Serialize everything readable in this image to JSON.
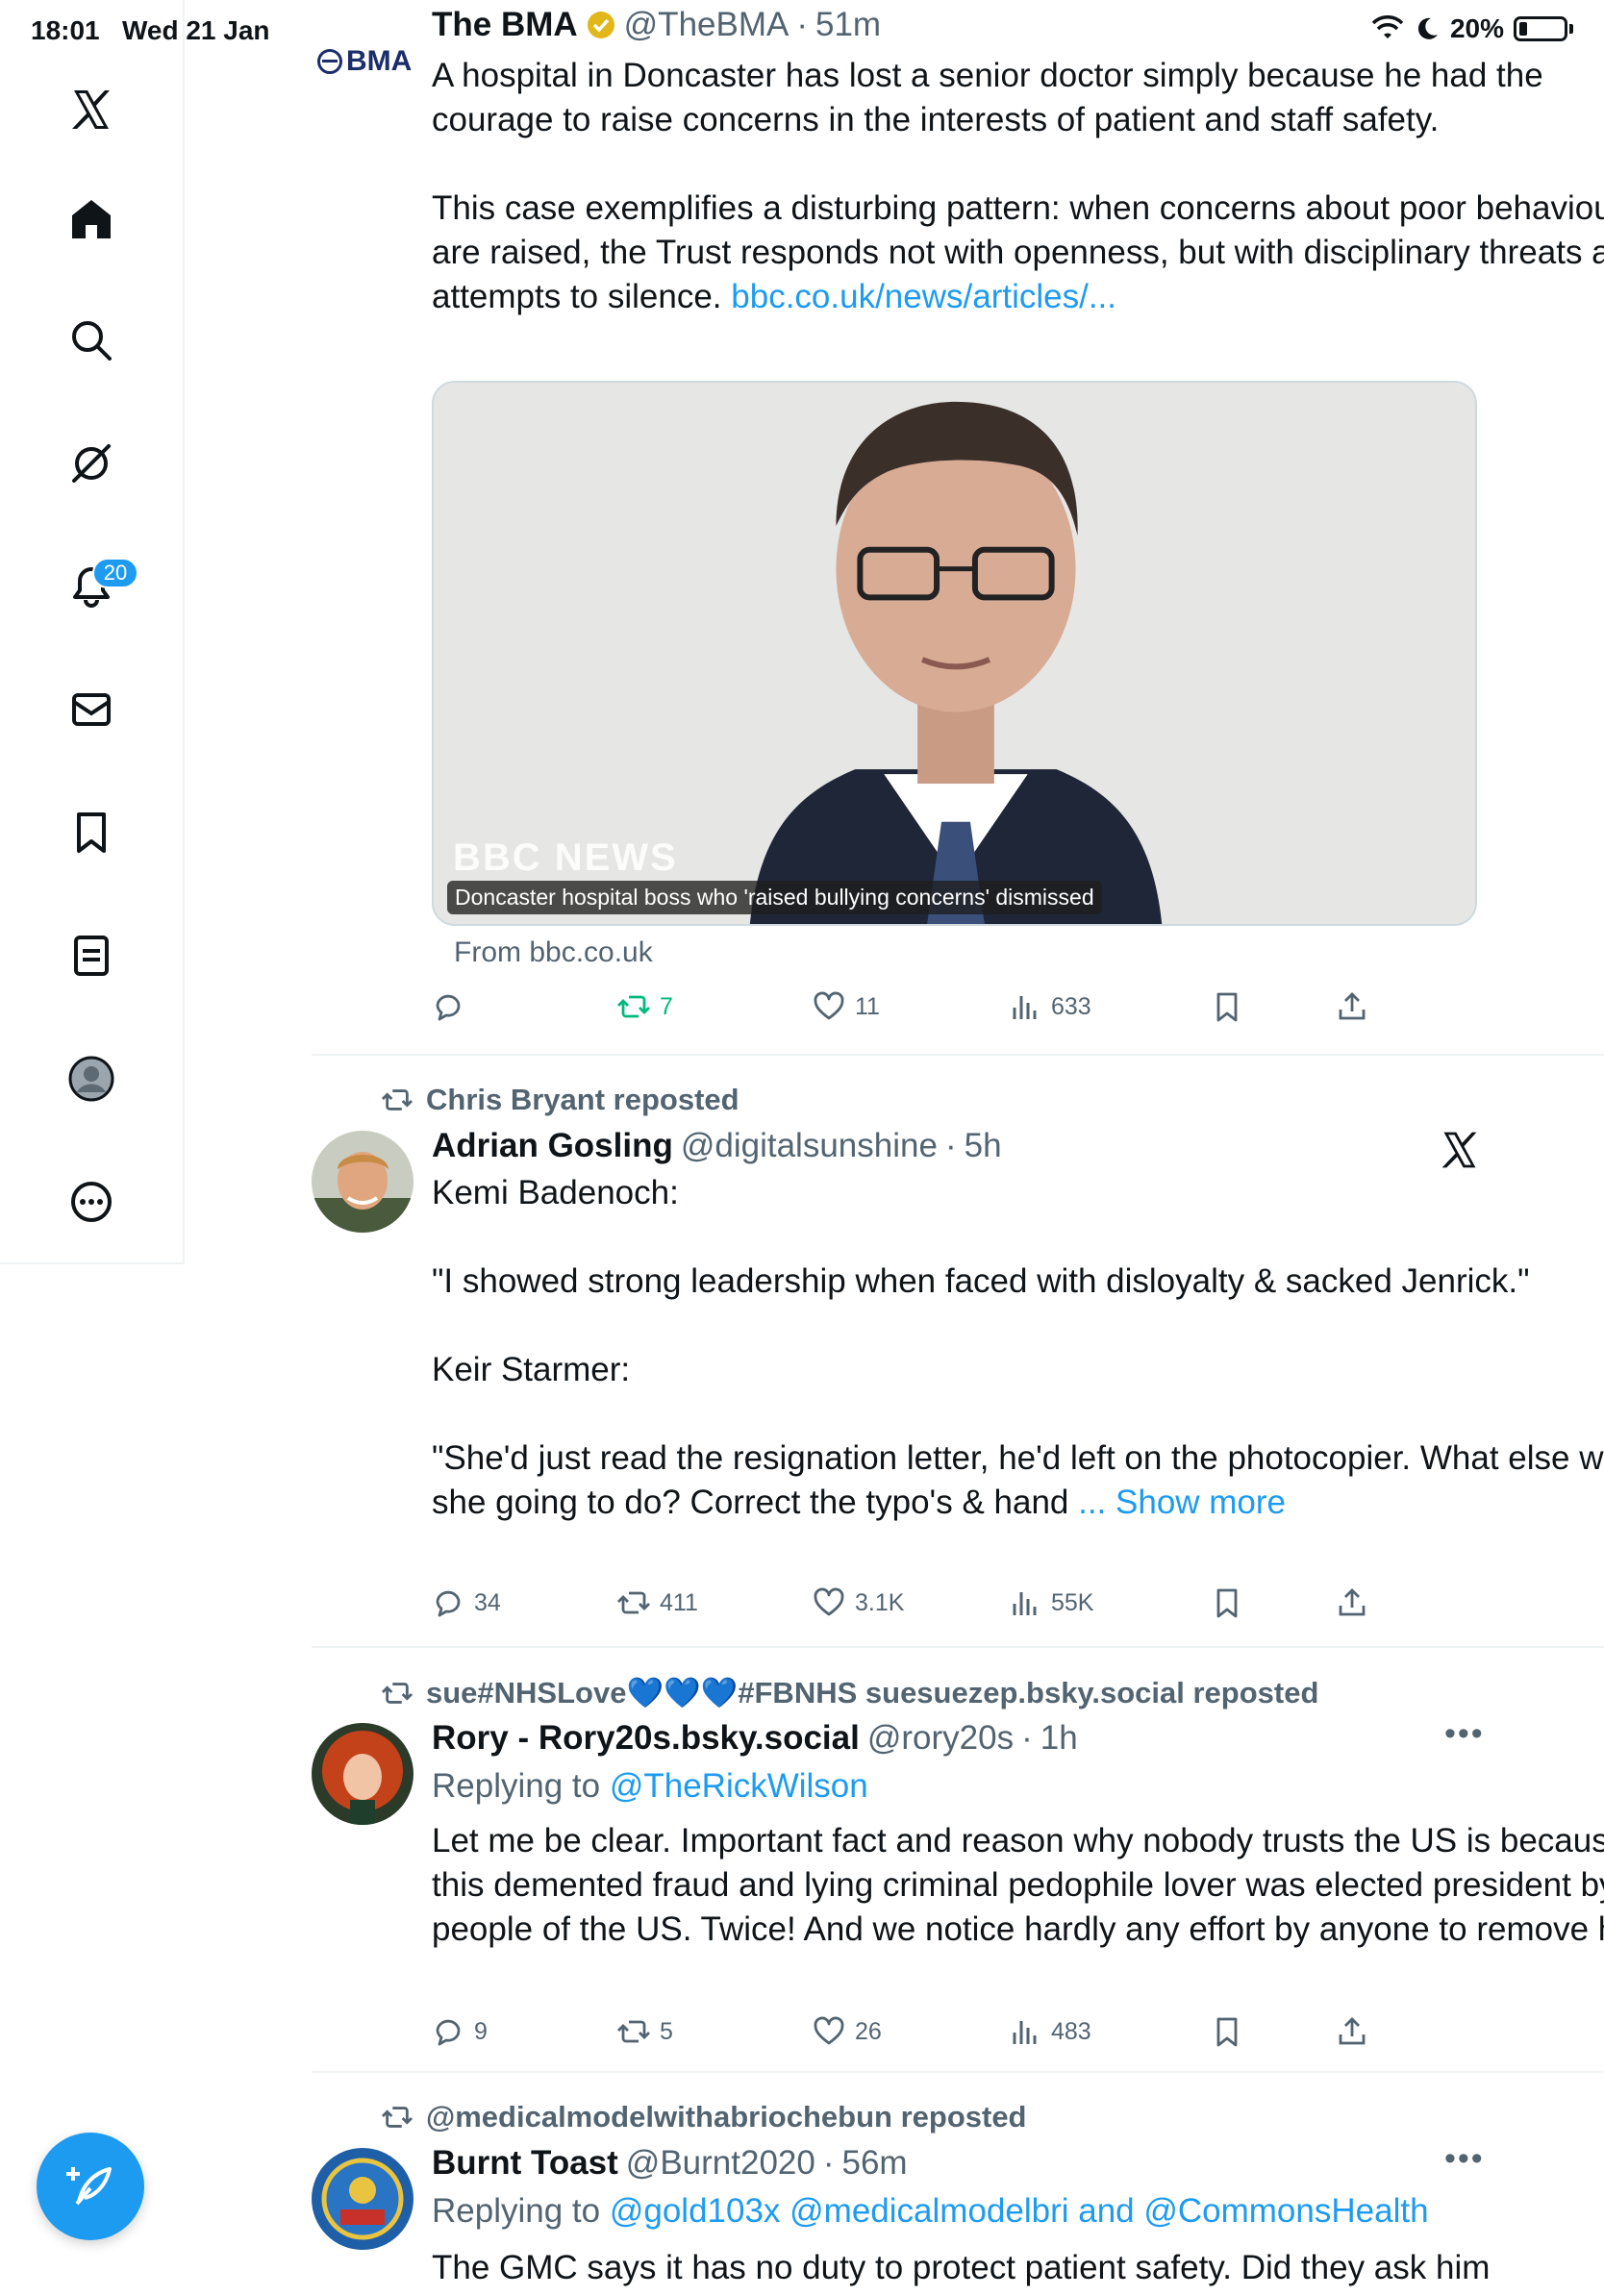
{
  "status_bar": {
    "time": "18:01",
    "date": "Wed 21 Jan",
    "battery": "20%"
  },
  "sidebar": {
    "items": [
      {
        "name": "x-logo"
      },
      {
        "name": "home"
      },
      {
        "name": "search"
      },
      {
        "name": "grok"
      },
      {
        "name": "notifications",
        "badge": "20"
      },
      {
        "name": "messages"
      },
      {
        "name": "bookmarks"
      },
      {
        "name": "lists"
      },
      {
        "name": "profile"
      },
      {
        "name": "more"
      }
    ],
    "compose_icon": "feather-plus-icon"
  },
  "posts": [
    {
      "avatar_text": "BMA",
      "name": "The BMA",
      "handle": "@TheBMA",
      "time": "51m",
      "verified": true,
      "body": "A hospital in Doncaster has lost a senior doctor simply because he had the courage to raise concerns in the interests of patient and staff safety.\n\nThis case exemplifies a disturbing pattern: when concerns about poor behaviour are raised, the Trust responds not with openness, but with disciplinary threats and attempts to silence. ",
      "link": "bbc.co.uk/news/articles/...",
      "media_caption": "Doncaster hospital boss who 'raised bullying concerns' dismissed",
      "media_watermark": "BBC NEWS",
      "from": "From bbc.co.uk",
      "stats": {
        "replies": "",
        "reposts": "7",
        "likes": "11",
        "views": "633"
      }
    },
    {
      "repost_by": "Chris Bryant reposted",
      "name": "Adrian Gosling",
      "handle": "@digitalsunshine",
      "time": "5h",
      "body": "Kemi Badenoch:\n\n\"I showed strong leadership when faced with disloyalty & sacked Jenrick.\"\n\nKeir Starmer:\n\n\"She'd just read the resignation letter, he'd left on the photocopier. What else was she going to do? Correct the typo's & hand ",
      "show_more": "... Show more",
      "stats": {
        "replies": "34",
        "reposts": "411",
        "likes": "3.1K",
        "views": "55K"
      }
    },
    {
      "repost_by": "sue#NHSLove💙💙💙#FBNHS suesuezep.bsky.social reposted",
      "name": "Rory - Rory20s.bsky.social",
      "handle": "@rory20s",
      "time": "1h",
      "reply_prefix": "Replying to ",
      "reply_to": "@TheRickWilson",
      "body": "Let me be clear. Important fact and reason why nobody trusts the US is because this demented fraud and lying criminal pedophile lover was elected president by the people of the US. Twice! And we notice hardly any effort by anyone to remove him.",
      "stats": {
        "replies": "9",
        "reposts": "5",
        "likes": "26",
        "views": "483"
      }
    },
    {
      "repost_by": "@medicalmodelwithabriochebun reposted",
      "name": "Burnt Toast",
      "handle": "@Burnt2020",
      "time": "56m",
      "reply_prefix": "Replying to ",
      "reply_to": "@gold103x @medicalmodelbri and @CommonsHealth",
      "body": "The GMC says it has no duty to protect patient safety. Did they ask him"
    }
  ],
  "colors": {
    "accent": "#1d9bf0",
    "repost_green": "#00ba7c",
    "muted": "#536471"
  }
}
